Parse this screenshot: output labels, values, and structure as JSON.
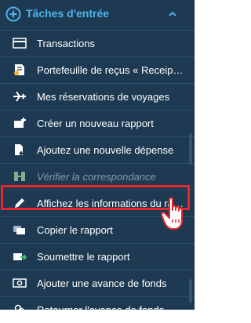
{
  "header": {
    "title": "Tâches d'entrée",
    "plus_icon": "plus-circle-icon",
    "chevron_icon": "chevron-up-icon",
    "accent": "#4db3e8"
  },
  "menu": {
    "items": [
      {
        "label": "Transactions",
        "icon": "card-icon",
        "disabled": false
      },
      {
        "label": "Portefeuille de reçus « Receipt ...",
        "icon": "receipt-wallet-icon",
        "disabled": false
      },
      {
        "label": "Mes réservations de voyages",
        "icon": "airplane-icon",
        "disabled": false
      },
      {
        "label": "Créer un nouveau rapport",
        "icon": "create-report-icon",
        "disabled": false
      },
      {
        "label": "Ajoutez une nouvelle dépense",
        "icon": "add-expense-icon",
        "disabled": false
      },
      {
        "label": "Vérifier la correspondance",
        "icon": "verify-match-icon",
        "disabled": true
      },
      {
        "label": "Affichez les informations du rapp...",
        "icon": "pencil-icon",
        "disabled": false
      },
      {
        "label": "Copier le rapport",
        "icon": "copy-report-icon",
        "disabled": false
      },
      {
        "label": "Soumettre le rapport",
        "icon": "submit-report-icon",
        "disabled": false
      },
      {
        "label": "Ajouter une avance de fonds",
        "icon": "cash-advance-icon",
        "disabled": false
      },
      {
        "label": "Retourner l'avance de fonds",
        "icon": "return-advance-icon",
        "disabled": false
      }
    ]
  },
  "highlight_color": "#e8262c"
}
